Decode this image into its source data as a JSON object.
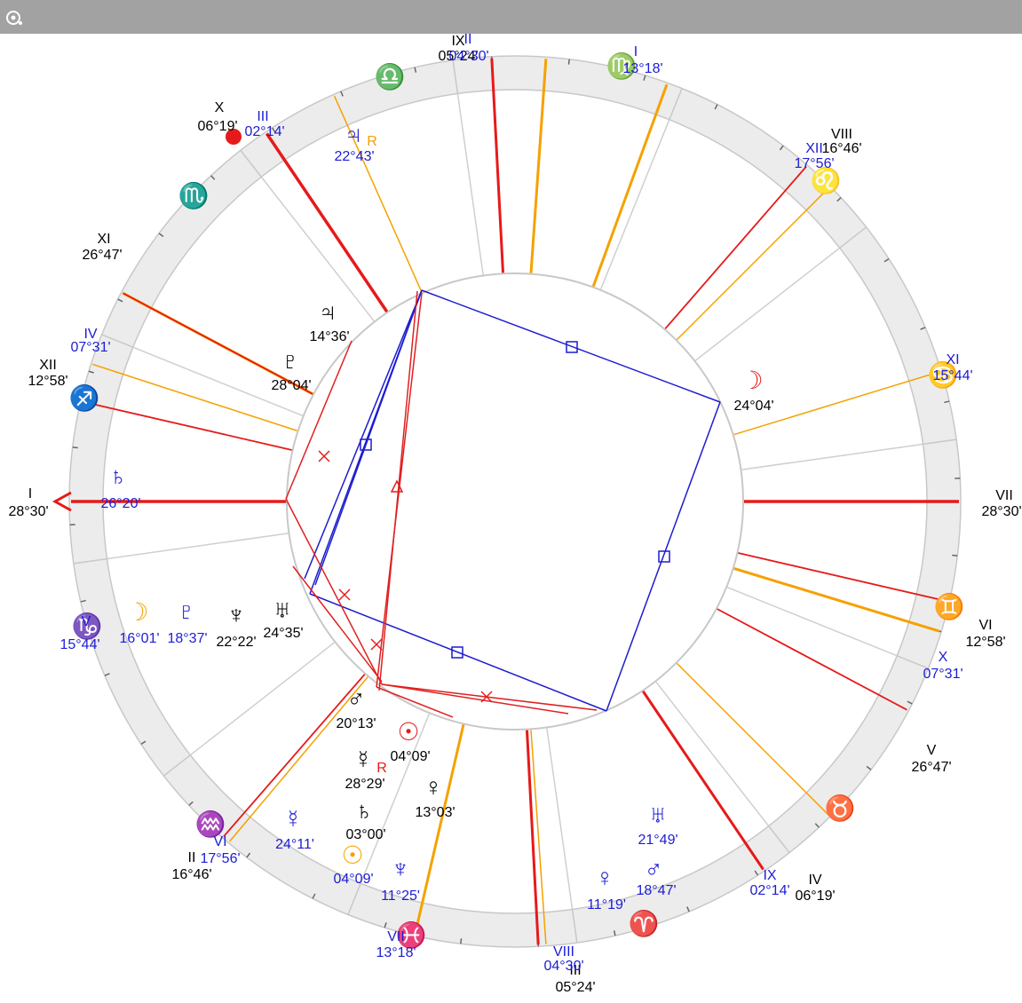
{
  "colors": {
    "titlebar": "#a2a2a2",
    "zodiac_band": "#ececec",
    "rim": "#c8c8c8",
    "natal": "#e61a1a",
    "transit": "#f5a100",
    "planet_blue": "#1c1cd4",
    "black": "#000000",
    "aspect_blue": "#1c1ccf",
    "aspect_red": "#e02020",
    "signs": {
      "libra": "#0b7a0b",
      "virgo": "#8a2be2",
      "leo": "#a52a2a",
      "cancer": "#0a8a8a",
      "gemini": "#0b7a0b",
      "taurus": "#8a2be2",
      "aries": "#a52a2a",
      "pisces": "#0a8a8a",
      "aquarius": "#0b7a0b",
      "capricorn": "#8a2be2",
      "sagittarius": "#a52a2a",
      "scorpio": "#0a8a8a"
    }
  },
  "icons": {
    "app": "chart-app-icon"
  },
  "signs": [
    {
      "name": "libra",
      "glyph": "♎"
    },
    {
      "name": "virgo",
      "glyph": "♍"
    },
    {
      "name": "leo",
      "glyph": "♌"
    },
    {
      "name": "cancer",
      "glyph": "♋"
    },
    {
      "name": "gemini",
      "glyph": "♊"
    },
    {
      "name": "taurus",
      "glyph": "♉"
    },
    {
      "name": "aries",
      "glyph": "♈"
    },
    {
      "name": "pisces",
      "glyph": "♓"
    },
    {
      "name": "aquarius",
      "glyph": "♒"
    },
    {
      "name": "capricorn",
      "glyph": "♑"
    },
    {
      "name": "sagittarius",
      "glyph": "♐"
    },
    {
      "name": "scorpio",
      "glyph": "♏"
    }
  ],
  "natal_cusps": [
    {
      "numeral": "I",
      "degree": "28°30'"
    },
    {
      "numeral": "II",
      "degree": "16°46'"
    },
    {
      "numeral": "III",
      "degree": "05°24'"
    },
    {
      "numeral": "IV",
      "degree": "06°19'"
    },
    {
      "numeral": "V",
      "degree": "26°47'"
    },
    {
      "numeral": "VI",
      "degree": "12°58'"
    },
    {
      "numeral": "VII",
      "degree": "28°30'"
    },
    {
      "numeral": "VIII",
      "degree": "16°46'"
    },
    {
      "numeral": "IX",
      "degree": "05°24'"
    },
    {
      "numeral": "X",
      "degree": "06°19'"
    },
    {
      "numeral": "XI",
      "degree": "26°47'"
    },
    {
      "numeral": "XII",
      "degree": "12°58'"
    }
  ],
  "transit_cusps": [
    {
      "numeral": "II",
      "degree": "04°30'"
    },
    {
      "numeral": "I",
      "degree": "13°18'"
    },
    {
      "numeral": "XII",
      "degree": "17°56'"
    },
    {
      "numeral": "XI",
      "degree": "15°44'"
    },
    {
      "numeral": "X",
      "degree": "07°31'"
    },
    {
      "numeral": "IX",
      "degree": "02°14'"
    },
    {
      "numeral": "VIII",
      "degree": "04°30'"
    },
    {
      "numeral": "VII",
      "degree": "13°18'"
    },
    {
      "numeral": "VI",
      "degree": "17°56'"
    },
    {
      "numeral": "V",
      "degree": "15°44'"
    },
    {
      "numeral": "IV",
      "degree": "07°31'"
    },
    {
      "numeral": "III",
      "degree": "02°14'"
    }
  ],
  "natal_planets": [
    {
      "name": "jupiter",
      "glyph": "♃",
      "degree": "14°36'"
    },
    {
      "name": "pluto",
      "glyph": "♇",
      "degree": "28°04'"
    },
    {
      "name": "moon",
      "glyph": "☽",
      "degree": "24°04'"
    },
    {
      "name": "uranus",
      "glyph": "♅",
      "degree": "24°35'"
    },
    {
      "name": "neptune",
      "glyph": "♆",
      "degree": "22°22'"
    },
    {
      "name": "mars",
      "glyph": "♂",
      "degree": "20°13'"
    },
    {
      "name": "sun",
      "glyph": "☉",
      "degree": "04°09'"
    },
    {
      "name": "mercury",
      "glyph": "☿",
      "degree": "28°29'",
      "retro": "R"
    },
    {
      "name": "venus",
      "glyph": "♀",
      "degree": "13°03'"
    },
    {
      "name": "saturn",
      "glyph": "♄",
      "degree": "03°00'"
    }
  ],
  "transit_planets": [
    {
      "name": "jupiter",
      "glyph": "♃",
      "degree": "22°43'",
      "retro": "R"
    },
    {
      "name": "saturn",
      "glyph": "♄",
      "degree": "26°20'"
    },
    {
      "name": "moon",
      "glyph": "☽",
      "degree": "16°01'"
    },
    {
      "name": "pluto",
      "glyph": "♇",
      "degree": "18°37'"
    },
    {
      "name": "mercury",
      "glyph": "☿",
      "degree": "24°11'"
    },
    {
      "name": "sun",
      "glyph": "☉",
      "degree": "04°09'"
    },
    {
      "name": "neptune",
      "glyph": "♆",
      "degree": "11°25'"
    },
    {
      "name": "venus",
      "glyph": "♀",
      "degree": "11°19'"
    },
    {
      "name": "mars",
      "glyph": "♂",
      "degree": "18°47'"
    },
    {
      "name": "uranus",
      "glyph": "♅",
      "degree": "21°49'"
    }
  ]
}
